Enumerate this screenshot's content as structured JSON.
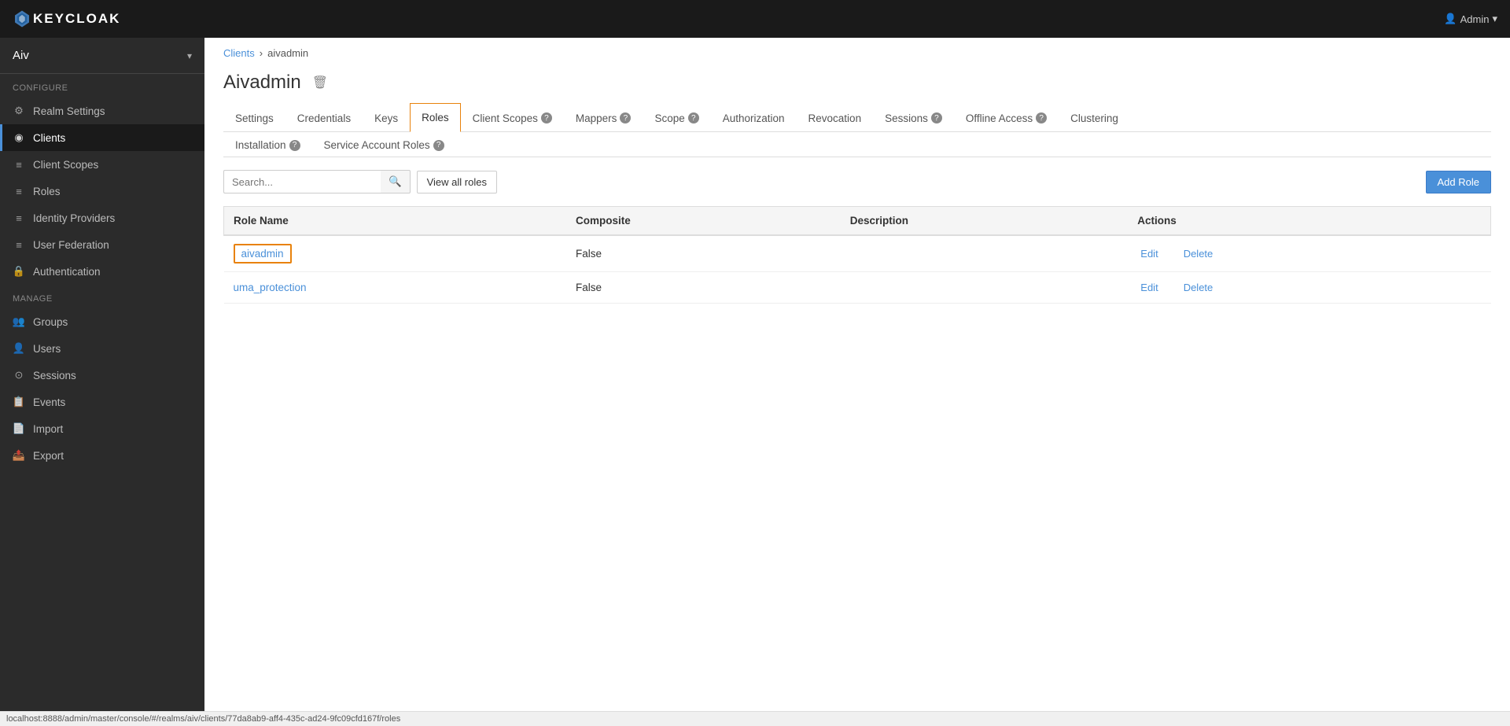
{
  "topNav": {
    "logoText": "KEYCLOAK",
    "userLabel": "Admin",
    "userIcon": "▾"
  },
  "sidebar": {
    "realmName": "Aiv",
    "configureLabel": "Configure",
    "manageLabel": "Manage",
    "configItems": [
      {
        "id": "realm-settings",
        "label": "Realm Settings",
        "icon": "⚙"
      },
      {
        "id": "clients",
        "label": "Clients",
        "icon": "◉",
        "active": true
      },
      {
        "id": "client-scopes",
        "label": "Client Scopes",
        "icon": "≡"
      },
      {
        "id": "roles",
        "label": "Roles",
        "icon": "≡"
      },
      {
        "id": "identity-providers",
        "label": "Identity Providers",
        "icon": "≡"
      },
      {
        "id": "user-federation",
        "label": "User Federation",
        "icon": "≡"
      },
      {
        "id": "authentication",
        "label": "Authentication",
        "icon": "🔒"
      }
    ],
    "manageItems": [
      {
        "id": "groups",
        "label": "Groups",
        "icon": "👥"
      },
      {
        "id": "users",
        "label": "Users",
        "icon": "👤"
      },
      {
        "id": "sessions",
        "label": "Sessions",
        "icon": "⊙"
      },
      {
        "id": "events",
        "label": "Events",
        "icon": "📋"
      },
      {
        "id": "import",
        "label": "Import",
        "icon": "📄"
      },
      {
        "id": "export",
        "label": "Export",
        "icon": "📤"
      }
    ]
  },
  "breadcrumb": {
    "parentLabel": "Clients",
    "currentLabel": "aivadmin"
  },
  "pageTitle": "Aivadmin",
  "tabs": [
    {
      "id": "settings",
      "label": "Settings",
      "help": false,
      "active": false
    },
    {
      "id": "credentials",
      "label": "Credentials",
      "help": false,
      "active": false
    },
    {
      "id": "keys",
      "label": "Keys",
      "help": false,
      "active": false
    },
    {
      "id": "roles",
      "label": "Roles",
      "help": false,
      "active": true
    },
    {
      "id": "client-scopes",
      "label": "Client Scopes",
      "help": true,
      "active": false
    },
    {
      "id": "mappers",
      "label": "Mappers",
      "help": true,
      "active": false
    },
    {
      "id": "scope",
      "label": "Scope",
      "help": true,
      "active": false
    },
    {
      "id": "authorization",
      "label": "Authorization",
      "help": false,
      "active": false
    },
    {
      "id": "revocation",
      "label": "Revocation",
      "help": false,
      "active": false
    },
    {
      "id": "sessions",
      "label": "Sessions",
      "help": true,
      "active": false
    },
    {
      "id": "offline-access",
      "label": "Offline Access",
      "help": true,
      "active": false
    },
    {
      "id": "clustering",
      "label": "Clustering",
      "help": false,
      "active": false
    }
  ],
  "tabs2": [
    {
      "id": "installation",
      "label": "Installation",
      "help": true
    },
    {
      "id": "service-account-roles",
      "label": "Service Account Roles",
      "help": true
    }
  ],
  "toolbar": {
    "searchPlaceholder": "Search...",
    "viewAllLabel": "View all roles",
    "addRoleLabel": "Add Role"
  },
  "tableHeaders": {
    "roleName": "Role Name",
    "composite": "Composite",
    "description": "Description",
    "actions": "Actions"
  },
  "tableRows": [
    {
      "roleName": "aivadmin",
      "composite": "False",
      "description": "",
      "editLabel": "Edit",
      "deleteLabel": "Delete",
      "highlighted": true
    },
    {
      "roleName": "uma_protection",
      "composite": "False",
      "description": "",
      "editLabel": "Edit",
      "deleteLabel": "Delete",
      "highlighted": false
    }
  ],
  "statusBar": {
    "url": "localhost:8888/admin/master/console/#/realms/aiv/clients/77da8ab9-aff4-435c-ad24-9fc09cfd167f/roles"
  }
}
